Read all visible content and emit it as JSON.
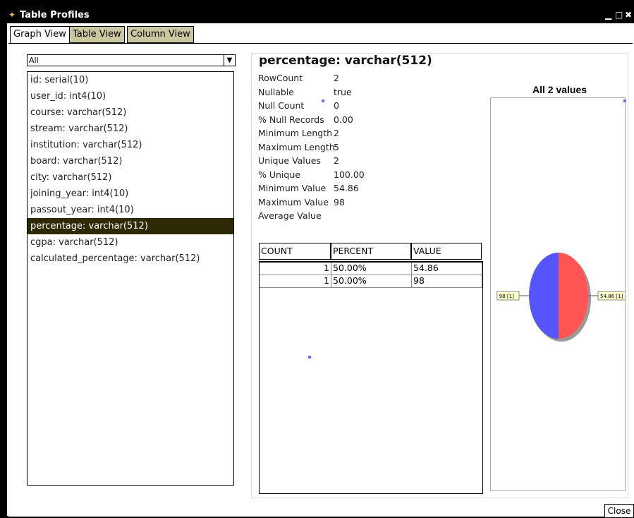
{
  "window": {
    "title": "Table Profiles",
    "controls": {
      "minimize": "▁",
      "maximize": "□",
      "close": "✖"
    }
  },
  "tabs": [
    {
      "label": "Graph View",
      "active": true
    },
    {
      "label": "Table View",
      "active": false
    },
    {
      "label": "Column View",
      "active": false
    }
  ],
  "filter": {
    "selected": "All"
  },
  "columns_list": [
    "id: serial(10)",
    "user_id: int4(10)",
    "course: varchar(512)",
    "stream: varchar(512)",
    "institution: varchar(512)",
    "board: varchar(512)",
    "city: varchar(512)",
    "joining_year: int4(10)",
    "passout_year: int4(10)",
    "percentage: varchar(512)",
    "cgpa: varchar(512)",
    "calculated_percentage: varchar(512)"
  ],
  "selected_column": "percentage: varchar(512)",
  "stats": [
    {
      "label": "RowCount",
      "value": "2"
    },
    {
      "label": "Nullable",
      "value": "true"
    },
    {
      "label": "Null Count",
      "value": "0"
    },
    {
      "label": "% Null Records",
      "value": "0.00"
    },
    {
      "label": "Minimum Length",
      "value": "2"
    },
    {
      "label": "Maximum Length",
      "value": "5"
    },
    {
      "label": "Unique Values",
      "value": "2"
    },
    {
      "label": "% Unique",
      "value": "100.00"
    },
    {
      "label": "Minimum Value",
      "value": "54.86"
    },
    {
      "label": "Maximum Value",
      "value": "98"
    },
    {
      "label": "Average Value",
      "value": ""
    }
  ],
  "value_table": {
    "headers": [
      "COUNT",
      "PERCENT",
      "VALUE"
    ],
    "rows": [
      [
        "1",
        "50.00%",
        "54.86"
      ],
      [
        "1",
        "50.00%",
        "98"
      ]
    ]
  },
  "chart_data": {
    "type": "pie",
    "title": "All 2 values",
    "categories": [
      "54.86 [1]",
      "98 [1]"
    ],
    "values": [
      1,
      1
    ],
    "colors": [
      "#ff5555",
      "#5555ff"
    ],
    "legend": false
  },
  "footer": {
    "close_label": "Close"
  }
}
